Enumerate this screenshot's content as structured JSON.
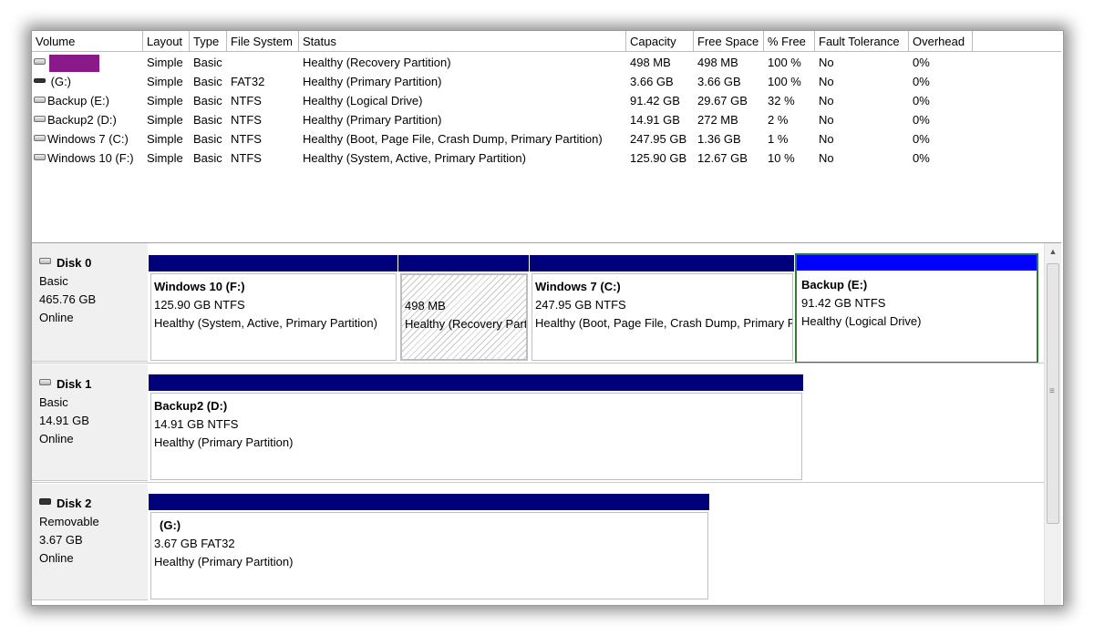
{
  "columns": [
    "Volume",
    "Layout",
    "Type",
    "File System",
    "Status",
    "Capacity",
    "Free Space",
    "% Free",
    "Fault Tolerance",
    "Overhead"
  ],
  "volumes": [
    {
      "volume": "",
      "layout": "Simple",
      "type": "Basic",
      "fs": "",
      "status": "Healthy (Recovery Partition)",
      "capacity": "498 MB",
      "free": "498 MB",
      "pct": "100 %",
      "fault": "No",
      "overhead": "0%"
    },
    {
      "volume": "(G:)",
      "layout": "Simple",
      "type": "Basic",
      "fs": "FAT32",
      "status": "Healthy (Primary Partition)",
      "capacity": "3.66 GB",
      "free": "3.66 GB",
      "pct": "100 %",
      "fault": "No",
      "overhead": "0%"
    },
    {
      "volume": "Backup (E:)",
      "layout": "Simple",
      "type": "Basic",
      "fs": "NTFS",
      "status": "Healthy (Logical Drive)",
      "capacity": "91.42 GB",
      "free": "29.67 GB",
      "pct": "32 %",
      "fault": "No",
      "overhead": "0%"
    },
    {
      "volume": "Backup2 (D:)",
      "layout": "Simple",
      "type": "Basic",
      "fs": "NTFS",
      "status": "Healthy (Primary Partition)",
      "capacity": "14.91 GB",
      "free": "272 MB",
      "pct": "2 %",
      "fault": "No",
      "overhead": "0%"
    },
    {
      "volume": "Windows 7 (C:)",
      "layout": "Simple",
      "type": "Basic",
      "fs": "NTFS",
      "status": "Healthy (Boot, Page File, Crash Dump, Primary Partition)",
      "capacity": "247.95 GB",
      "free": "1.36 GB",
      "pct": "1 %",
      "fault": "No",
      "overhead": "0%"
    },
    {
      "volume": "Windows 10 (F:)",
      "layout": "Simple",
      "type": "Basic",
      "fs": "NTFS",
      "status": "Healthy (System, Active, Primary Partition)",
      "capacity": "125.90 GB",
      "free": "12.67 GB",
      "pct": "10 %",
      "fault": "No",
      "overhead": "0%"
    }
  ],
  "disks": [
    {
      "title": "Disk 0",
      "type": "Basic",
      "size": "465.76 GB",
      "state": "Online",
      "partitions": [
        {
          "name": "Windows 10  (F:)",
          "size": "125.90 GB NTFS",
          "status": "Healthy (System, Active, Primary Partition)"
        },
        {
          "name": "",
          "size": "498 MB",
          "status": "Healthy (Recovery Partition)"
        },
        {
          "name": "Windows 7  (C:)",
          "size": "247.95 GB NTFS",
          "status": "Healthy (Boot, Page File, Crash Dump, Primary Partition)"
        },
        {
          "name": "Backup  (E:)",
          "size": "91.42 GB NTFS",
          "status": "Healthy (Logical Drive)"
        }
      ]
    },
    {
      "title": "Disk 1",
      "type": "Basic",
      "size": "14.91 GB",
      "state": "Online",
      "partitions": [
        {
          "name": "Backup2  (D:)",
          "size": "14.91 GB NTFS",
          "status": "Healthy (Primary Partition)"
        }
      ]
    },
    {
      "title": "Disk 2",
      "type": "Removable",
      "size": "3.67 GB",
      "state": "Online",
      "partitions": [
        {
          "name": "(G:)",
          "size": "3.67 GB FAT32",
          "status": "Healthy (Primary Partition)"
        }
      ]
    }
  ],
  "colors": {
    "partition_bar": "#00007b",
    "selected_bar": "#0000ff",
    "selected_border": "#2e7d32",
    "redaction": "#8a1a8a"
  },
  "icons": {
    "volume": "drive-icon",
    "disk": "disk-icon"
  }
}
